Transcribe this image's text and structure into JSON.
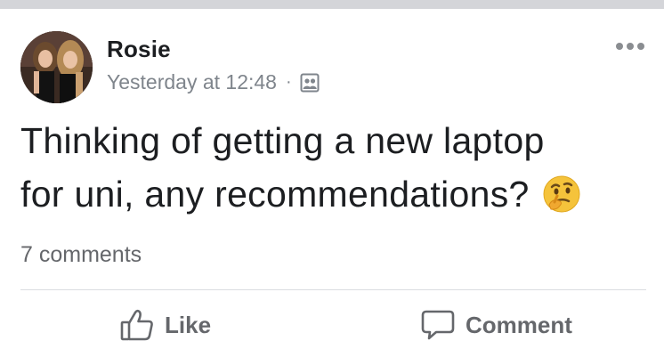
{
  "post": {
    "author": "Rosie",
    "timestamp": "Yesterday at 12:48",
    "separator": "·",
    "audience_icon": "friends-audience-icon",
    "text_line1": "Thinking of getting a new laptop",
    "text_line2": "for uni, any recommendations?",
    "emoji": "thinking-face-emoji",
    "comments_count": "7 comments"
  },
  "actions": {
    "like_label": "Like",
    "comment_label": "Comment"
  },
  "colors": {
    "text_primary": "#1c1e21",
    "text_secondary": "#65676b",
    "divider": "#dadde1",
    "top_strip": "#d4d5d9"
  }
}
